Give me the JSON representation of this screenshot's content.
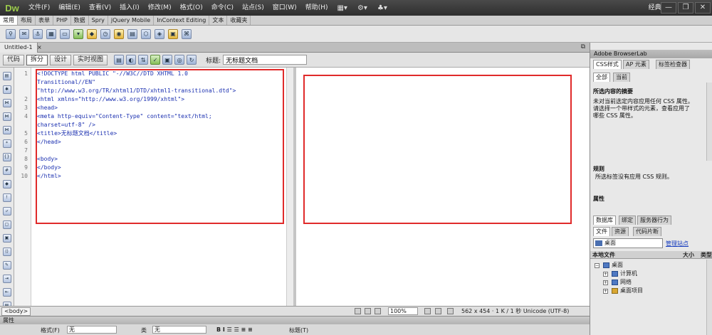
{
  "app": {
    "logo": "Dw"
  },
  "menu": [
    "文件(F)",
    "编辑(E)",
    "查看(V)",
    "插入(I)",
    "修改(M)",
    "格式(O)",
    "命令(C)",
    "站点(S)",
    "窗口(W)",
    "帮助(H)"
  ],
  "menu_tools": [
    "▦▾",
    "⚙▾",
    "♣▾"
  ],
  "workspace": "经典 ▾",
  "window_buttons": [
    "—",
    "❐",
    "✕"
  ],
  "insert_tabs": [
    "常用",
    "布局",
    "表单",
    "PHP",
    "数据",
    "Spry",
    "jQuery Mobile",
    "InContext Editing",
    "文本",
    "收藏夹"
  ],
  "insert_icons": [
    "link",
    "email",
    "anchor",
    "table",
    "div",
    "image",
    "media",
    "date",
    "server",
    "comment",
    "head",
    "script",
    "template",
    "tag"
  ],
  "document": {
    "tab": "Untitled-1",
    "close": "×",
    "path_icon": "⧉",
    "view_buttons": [
      "代码",
      "拆分",
      "设计",
      "实时视图"
    ],
    "active_view": "拆分",
    "title_label": "标题:",
    "title_value": "无标题文档"
  },
  "code": {
    "line_numbers": [
      "1",
      "2",
      "3",
      "4",
      "5",
      "6",
      "7",
      "8",
      "9",
      "10"
    ],
    "lines": [
      "<!DOCTYPE html PUBLIC \"-//W3C//DTD XHTML 1.0",
      "Transitional//EN\"",
      "\"http://www.w3.org/TR/xhtml1/DTD/xhtml1-transitional.dtd\">",
      "<html xmlns=\"http://www.w3.org/1999/xhtml\">",
      "<head>",
      "<meta http-equiv=\"Content-Type\" content=\"text/html;",
      "charset=utf-8\" />",
      "<title>无标题文档</title>",
      "</head>",
      "",
      "<body>",
      "</body>",
      "</html>"
    ]
  },
  "status": {
    "tag": "<body>",
    "zoom": "100%",
    "info": "562 x 454 · 1 K / 1 秒 Unicode (UTF-8)"
  },
  "properties": {
    "header": "属性",
    "format_label": "格式(F)",
    "format_value": "无",
    "class_label": "类",
    "class_value": "无",
    "buttons": "B I  ☰ ☰ ≡ ≡",
    "title_label": "标题(T)"
  },
  "right": {
    "browserlab": "Adobe BrowserLab",
    "css_tabs": [
      "CSS样式",
      "AP 元素",
      "标签检查器"
    ],
    "mode_tabs": [
      "全部",
      "当前"
    ],
    "summary_title": "所选内容的摘要",
    "summary_text": [
      "未对当前选定内容应用任何 CSS 属性。",
      "请选择一个带样式的元素，查看应用了",
      "哪些 CSS 属性。"
    ],
    "rules_title": "规则",
    "rules_text": "所选标签没有应用 CSS 规则。",
    "attributes_title": "属性",
    "db_tabs": [
      "数据库",
      "绑定",
      "服务器行为"
    ],
    "file_tabs": [
      "文件",
      "资源",
      "代码片断"
    ],
    "site_select": "桌面",
    "manage_sites": "管理站点",
    "file_header": {
      "name": "本地文件",
      "size": "大小",
      "type": "类型"
    },
    "tree": [
      "桌面",
      "计算机",
      "网络",
      "桌面项目"
    ]
  }
}
